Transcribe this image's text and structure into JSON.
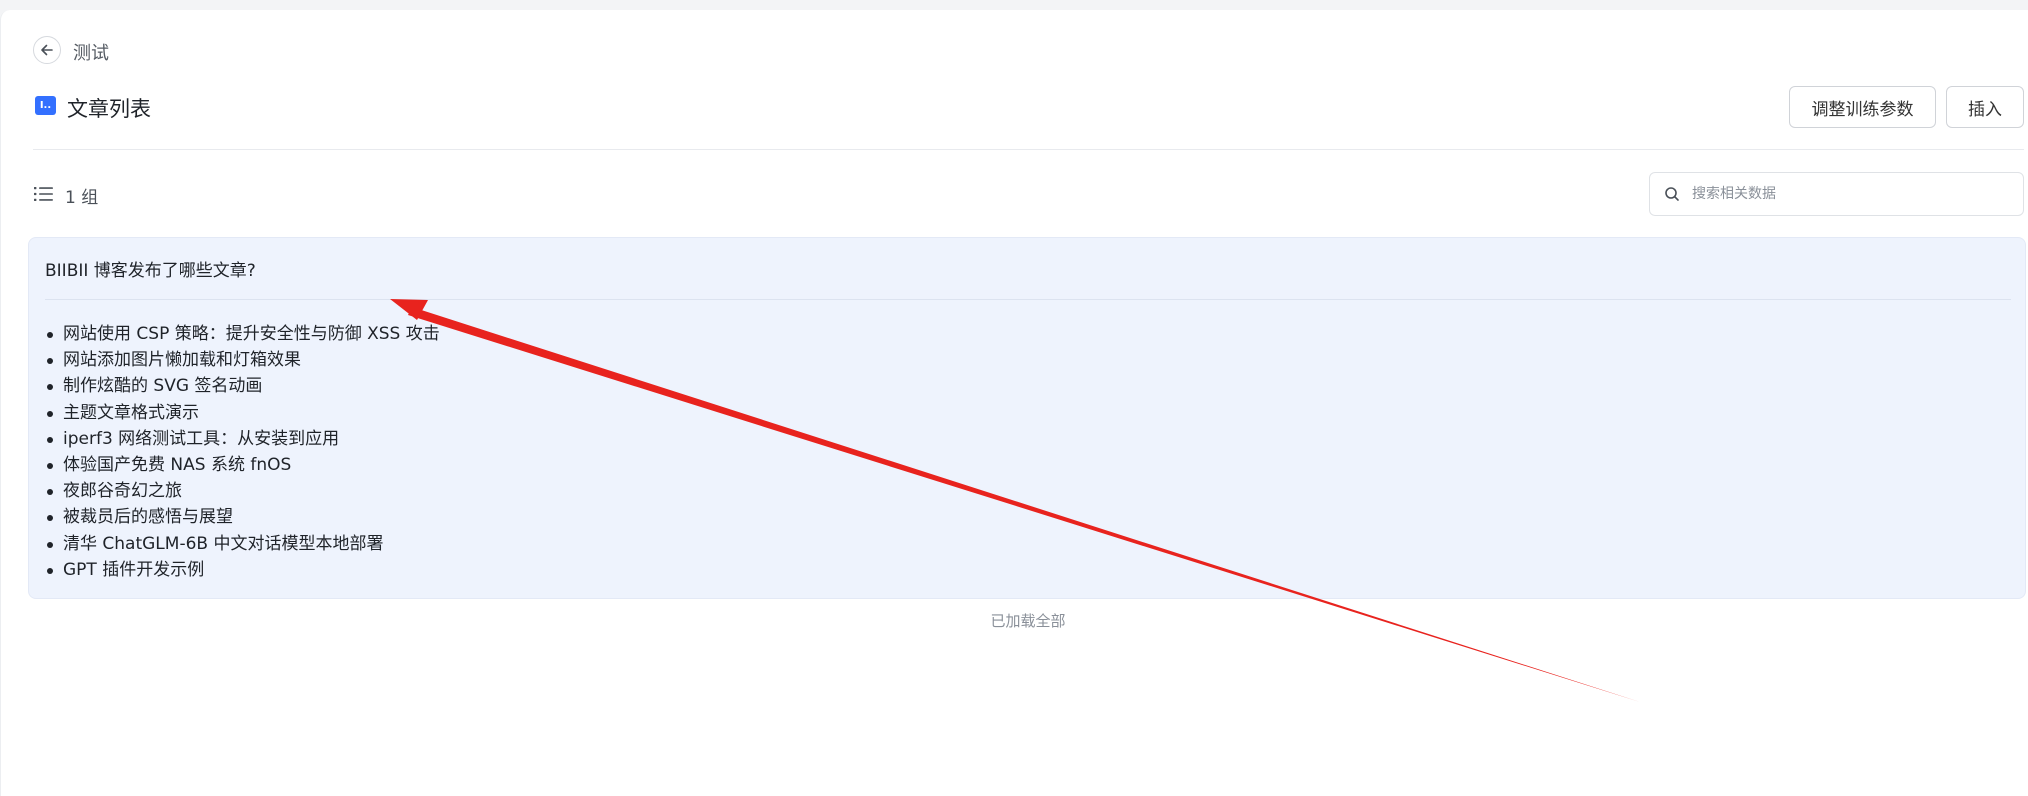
{
  "header": {
    "back_label": "测试",
    "title": "文章列表",
    "title_icon_glyph": "I..",
    "buttons": {
      "train_label": "调整训练参数",
      "insert_label": "插入"
    }
  },
  "toolbar": {
    "group_count": "1 组",
    "search_placeholder": "搜索相关数据"
  },
  "card": {
    "question": "BIIBII 博客发布了哪些文章?",
    "answers": [
      "网站使用 CSP 策略：提升安全性与防御 XSS 攻击",
      "网站添加图片懒加载和灯箱效果",
      "制作炫酷的 SVG 签名动画",
      "主题文章格式演示",
      "iperf3 网络测试工具：从安装到应用",
      "体验国产免费 NAS 系统 fnOS",
      "夜郎谷奇幻之旅",
      "被裁员后的感悟与展望",
      "清华 ChatGLM-6B 中文对话模型本地部署",
      "GPT 插件开发示例"
    ]
  },
  "footer_note": "已加载全部",
  "colors": {
    "accent": "#3370ff",
    "card_bg": "#eef3fd",
    "annotation_arrow": "#e8231e"
  }
}
